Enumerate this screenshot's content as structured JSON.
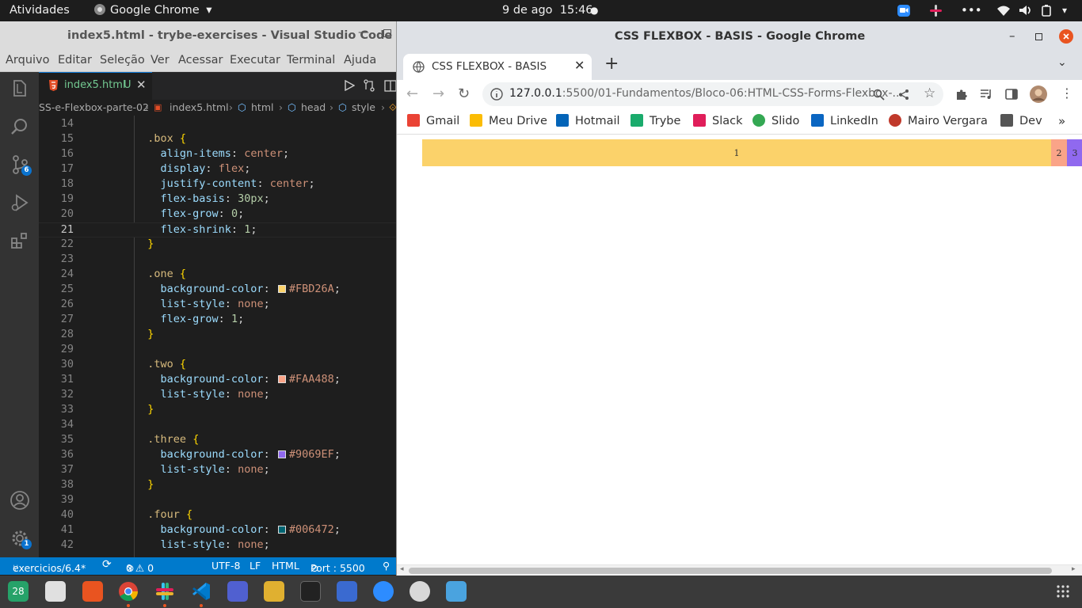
{
  "topbar": {
    "activities": "Atividades",
    "app_name": "Google Chrome",
    "app_arrow": "▾",
    "date": "9 de ago",
    "time": "15:46"
  },
  "vscode": {
    "title": "index5.html - trybe-exercises - Visual Studio Code",
    "menu": [
      "Arquivo",
      "Editar",
      "Seleção",
      "Ver",
      "Acessar",
      "Executar",
      "Terminal",
      "Ajuda"
    ],
    "tab": {
      "label": "index5.html",
      "status": "U"
    },
    "breadcrumb": [
      "SS-e-Flexbox-parte-02",
      "index5.html",
      "html",
      "head",
      "style"
    ],
    "source_control_badge": "6",
    "settings_badge": "1",
    "status": {
      "branch": "exercicios/6.4*",
      "problems": "0 ⚠ 0",
      "encoding": "UTF-8",
      "eol": "LF",
      "language": "HTML",
      "port": "Port : 5500"
    },
    "code_lines": [
      {
        "n": "14",
        "parts": []
      },
      {
        "n": "15",
        "parts": [
          [
            "  ",
            "p"
          ],
          [
            ".box",
            "sel"
          ],
          [
            " ",
            "p"
          ],
          [
            "{",
            "br"
          ]
        ]
      },
      {
        "n": "16",
        "parts": [
          [
            "    ",
            "p"
          ],
          [
            "align-items",
            "prop"
          ],
          [
            ": ",
            "p"
          ],
          [
            "center",
            "val"
          ],
          [
            ";",
            "p"
          ]
        ]
      },
      {
        "n": "17",
        "parts": [
          [
            "    ",
            "p"
          ],
          [
            "display",
            "prop"
          ],
          [
            ": ",
            "p"
          ],
          [
            "flex",
            "val"
          ],
          [
            ";",
            "p"
          ]
        ]
      },
      {
        "n": "18",
        "parts": [
          [
            "    ",
            "p"
          ],
          [
            "justify-content",
            "prop"
          ],
          [
            ": ",
            "p"
          ],
          [
            "center",
            "val"
          ],
          [
            ";",
            "p"
          ]
        ]
      },
      {
        "n": "19",
        "parts": [
          [
            "    ",
            "p"
          ],
          [
            "flex-basis",
            "prop"
          ],
          [
            ": ",
            "p"
          ],
          [
            "30px",
            "num"
          ],
          [
            ";",
            "p"
          ]
        ]
      },
      {
        "n": "20",
        "parts": [
          [
            "    ",
            "p"
          ],
          [
            "flex-grow",
            "prop"
          ],
          [
            ": ",
            "p"
          ],
          [
            "0",
            "num"
          ],
          [
            ";",
            "p"
          ]
        ]
      },
      {
        "n": "21",
        "parts": [
          [
            "    ",
            "p"
          ],
          [
            "flex-shrink",
            "prop"
          ],
          [
            ": ",
            "p"
          ],
          [
            "1",
            "num"
          ],
          [
            ";",
            "p"
          ]
        ]
      },
      {
        "n": "22",
        "parts": [
          [
            "  ",
            "p"
          ],
          [
            "}",
            "br"
          ]
        ]
      },
      {
        "n": "23",
        "parts": []
      },
      {
        "n": "24",
        "parts": [
          [
            "  ",
            "p"
          ],
          [
            ".one",
            "sel"
          ],
          [
            " ",
            "p"
          ],
          [
            "{",
            "br"
          ]
        ]
      },
      {
        "n": "25",
        "parts": [
          [
            "    ",
            "p"
          ],
          [
            "background-color",
            "prop"
          ],
          [
            ": ",
            "p"
          ],
          [
            "#FBD26A",
            "swatch"
          ],
          [
            ";",
            "p"
          ]
        ]
      },
      {
        "n": "26",
        "parts": [
          [
            "    ",
            "p"
          ],
          [
            "list-style",
            "prop"
          ],
          [
            ": ",
            "p"
          ],
          [
            "none",
            "val"
          ],
          [
            ";",
            "p"
          ]
        ]
      },
      {
        "n": "27",
        "parts": [
          [
            "    ",
            "p"
          ],
          [
            "flex-grow",
            "prop"
          ],
          [
            ": ",
            "p"
          ],
          [
            "1",
            "num"
          ],
          [
            ";",
            "p"
          ]
        ]
      },
      {
        "n": "28",
        "parts": [
          [
            "  ",
            "p"
          ],
          [
            "}",
            "br"
          ]
        ]
      },
      {
        "n": "29",
        "parts": []
      },
      {
        "n": "30",
        "parts": [
          [
            "  ",
            "p"
          ],
          [
            ".two",
            "sel"
          ],
          [
            " ",
            "p"
          ],
          [
            "{",
            "br"
          ]
        ]
      },
      {
        "n": "31",
        "parts": [
          [
            "    ",
            "p"
          ],
          [
            "background-color",
            "prop"
          ],
          [
            ": ",
            "p"
          ],
          [
            "#FAA488",
            "swatch"
          ],
          [
            ";",
            "p"
          ]
        ]
      },
      {
        "n": "32",
        "parts": [
          [
            "    ",
            "p"
          ],
          [
            "list-style",
            "prop"
          ],
          [
            ": ",
            "p"
          ],
          [
            "none",
            "val"
          ],
          [
            ";",
            "p"
          ]
        ]
      },
      {
        "n": "33",
        "parts": [
          [
            "  ",
            "p"
          ],
          [
            "}",
            "br"
          ]
        ]
      },
      {
        "n": "34",
        "parts": []
      },
      {
        "n": "35",
        "parts": [
          [
            "  ",
            "p"
          ],
          [
            ".three",
            "sel"
          ],
          [
            " ",
            "p"
          ],
          [
            "{",
            "br"
          ]
        ]
      },
      {
        "n": "36",
        "parts": [
          [
            "    ",
            "p"
          ],
          [
            "background-color",
            "prop"
          ],
          [
            ": ",
            "p"
          ],
          [
            "#9069EF",
            "swatch"
          ],
          [
            ";",
            "p"
          ]
        ]
      },
      {
        "n": "37",
        "parts": [
          [
            "    ",
            "p"
          ],
          [
            "list-style",
            "prop"
          ],
          [
            ": ",
            "p"
          ],
          [
            "none",
            "val"
          ],
          [
            ";",
            "p"
          ]
        ]
      },
      {
        "n": "38",
        "parts": [
          [
            "  ",
            "p"
          ],
          [
            "}",
            "br"
          ]
        ]
      },
      {
        "n": "39",
        "parts": []
      },
      {
        "n": "40",
        "parts": [
          [
            "  ",
            "p"
          ],
          [
            ".four",
            "sel"
          ],
          [
            " ",
            "p"
          ],
          [
            "{",
            "br"
          ]
        ]
      },
      {
        "n": "41",
        "parts": [
          [
            "    ",
            "p"
          ],
          [
            "background-color",
            "prop"
          ],
          [
            ": ",
            "p"
          ],
          [
            "#006472",
            "swatch"
          ],
          [
            ";",
            "p"
          ]
        ]
      },
      {
        "n": "42",
        "parts": [
          [
            "    ",
            "p"
          ],
          [
            "list-style",
            "prop"
          ],
          [
            ": ",
            "p"
          ],
          [
            "none",
            "val"
          ],
          [
            ";",
            "p"
          ]
        ]
      }
    ],
    "current_line": "21"
  },
  "chrome": {
    "window_title": "CSS FLEXBOX - BASIS - Google Chrome",
    "tab_title": "CSS FLEXBOX - BASIS",
    "url_host": "127.0.0.1",
    "url_rest": ":5500/01-Fundamentos/Bloco-06:HTML-CSS-Forms-Flexbox-...",
    "bookmarks": [
      {
        "name": "Gmail",
        "color": "#ea4335"
      },
      {
        "name": "Meu Drive",
        "color": "#fbbc04"
      },
      {
        "name": "Hotmail",
        "color": "#0364b8"
      },
      {
        "name": "Trybe",
        "color": "#1aab6c"
      },
      {
        "name": "Slack",
        "color": "#e01e5a"
      },
      {
        "name": "Slido",
        "color": "#34a853"
      },
      {
        "name": "LinkedIn",
        "color": "#0a66c2"
      },
      {
        "name": "Mairo Vergara",
        "color": "#c0392b"
      },
      {
        "name": "Dev",
        "color": "#555555"
      }
    ],
    "bookmarks_more": "»",
    "flex_boxes": [
      {
        "label": "1",
        "color": "#FBD26A"
      },
      {
        "label": "2",
        "color": "#FAA488"
      },
      {
        "label": "3",
        "color": "#9069EF"
      }
    ]
  },
  "dock": {
    "calendar_day": "28"
  }
}
